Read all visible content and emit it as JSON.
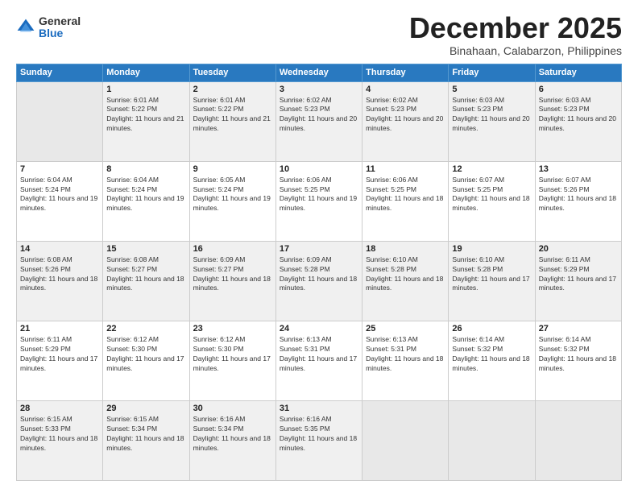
{
  "header": {
    "logo_general": "General",
    "logo_blue": "Blue",
    "month_title": "December 2025",
    "location": "Binahaan, Calabarzon, Philippines"
  },
  "days_of_week": [
    "Sunday",
    "Monday",
    "Tuesday",
    "Wednesday",
    "Thursday",
    "Friday",
    "Saturday"
  ],
  "weeks": [
    [
      {
        "num": "",
        "empty": true
      },
      {
        "num": "1",
        "sunrise": "6:01 AM",
        "sunset": "5:22 PM",
        "daylight": "11 hours and 21 minutes."
      },
      {
        "num": "2",
        "sunrise": "6:01 AM",
        "sunset": "5:22 PM",
        "daylight": "11 hours and 21 minutes."
      },
      {
        "num": "3",
        "sunrise": "6:02 AM",
        "sunset": "5:23 PM",
        "daylight": "11 hours and 20 minutes."
      },
      {
        "num": "4",
        "sunrise": "6:02 AM",
        "sunset": "5:23 PM",
        "daylight": "11 hours and 20 minutes."
      },
      {
        "num": "5",
        "sunrise": "6:03 AM",
        "sunset": "5:23 PM",
        "daylight": "11 hours and 20 minutes."
      },
      {
        "num": "6",
        "sunrise": "6:03 AM",
        "sunset": "5:23 PM",
        "daylight": "11 hours and 20 minutes."
      }
    ],
    [
      {
        "num": "7",
        "sunrise": "6:04 AM",
        "sunset": "5:24 PM",
        "daylight": "11 hours and 19 minutes."
      },
      {
        "num": "8",
        "sunrise": "6:04 AM",
        "sunset": "5:24 PM",
        "daylight": "11 hours and 19 minutes."
      },
      {
        "num": "9",
        "sunrise": "6:05 AM",
        "sunset": "5:24 PM",
        "daylight": "11 hours and 19 minutes."
      },
      {
        "num": "10",
        "sunrise": "6:06 AM",
        "sunset": "5:25 PM",
        "daylight": "11 hours and 19 minutes."
      },
      {
        "num": "11",
        "sunrise": "6:06 AM",
        "sunset": "5:25 PM",
        "daylight": "11 hours and 18 minutes."
      },
      {
        "num": "12",
        "sunrise": "6:07 AM",
        "sunset": "5:25 PM",
        "daylight": "11 hours and 18 minutes."
      },
      {
        "num": "13",
        "sunrise": "6:07 AM",
        "sunset": "5:26 PM",
        "daylight": "11 hours and 18 minutes."
      }
    ],
    [
      {
        "num": "14",
        "sunrise": "6:08 AM",
        "sunset": "5:26 PM",
        "daylight": "11 hours and 18 minutes."
      },
      {
        "num": "15",
        "sunrise": "6:08 AM",
        "sunset": "5:27 PM",
        "daylight": "11 hours and 18 minutes."
      },
      {
        "num": "16",
        "sunrise": "6:09 AM",
        "sunset": "5:27 PM",
        "daylight": "11 hours and 18 minutes."
      },
      {
        "num": "17",
        "sunrise": "6:09 AM",
        "sunset": "5:28 PM",
        "daylight": "11 hours and 18 minutes."
      },
      {
        "num": "18",
        "sunrise": "6:10 AM",
        "sunset": "5:28 PM",
        "daylight": "11 hours and 18 minutes."
      },
      {
        "num": "19",
        "sunrise": "6:10 AM",
        "sunset": "5:28 PM",
        "daylight": "11 hours and 17 minutes."
      },
      {
        "num": "20",
        "sunrise": "6:11 AM",
        "sunset": "5:29 PM",
        "daylight": "11 hours and 17 minutes."
      }
    ],
    [
      {
        "num": "21",
        "sunrise": "6:11 AM",
        "sunset": "5:29 PM",
        "daylight": "11 hours and 17 minutes."
      },
      {
        "num": "22",
        "sunrise": "6:12 AM",
        "sunset": "5:30 PM",
        "daylight": "11 hours and 17 minutes."
      },
      {
        "num": "23",
        "sunrise": "6:12 AM",
        "sunset": "5:30 PM",
        "daylight": "11 hours and 17 minutes."
      },
      {
        "num": "24",
        "sunrise": "6:13 AM",
        "sunset": "5:31 PM",
        "daylight": "11 hours and 17 minutes."
      },
      {
        "num": "25",
        "sunrise": "6:13 AM",
        "sunset": "5:31 PM",
        "daylight": "11 hours and 18 minutes."
      },
      {
        "num": "26",
        "sunrise": "6:14 AM",
        "sunset": "5:32 PM",
        "daylight": "11 hours and 18 minutes."
      },
      {
        "num": "27",
        "sunrise": "6:14 AM",
        "sunset": "5:32 PM",
        "daylight": "11 hours and 18 minutes."
      }
    ],
    [
      {
        "num": "28",
        "sunrise": "6:15 AM",
        "sunset": "5:33 PM",
        "daylight": "11 hours and 18 minutes."
      },
      {
        "num": "29",
        "sunrise": "6:15 AM",
        "sunset": "5:34 PM",
        "daylight": "11 hours and 18 minutes."
      },
      {
        "num": "30",
        "sunrise": "6:16 AM",
        "sunset": "5:34 PM",
        "daylight": "11 hours and 18 minutes."
      },
      {
        "num": "31",
        "sunrise": "6:16 AM",
        "sunset": "5:35 PM",
        "daylight": "11 hours and 18 minutes."
      },
      {
        "num": "",
        "empty": true
      },
      {
        "num": "",
        "empty": true
      },
      {
        "num": "",
        "empty": true
      }
    ]
  ],
  "labels": {
    "sunrise_prefix": "Sunrise: ",
    "sunset_prefix": "Sunset: ",
    "daylight_prefix": "Daylight: "
  }
}
